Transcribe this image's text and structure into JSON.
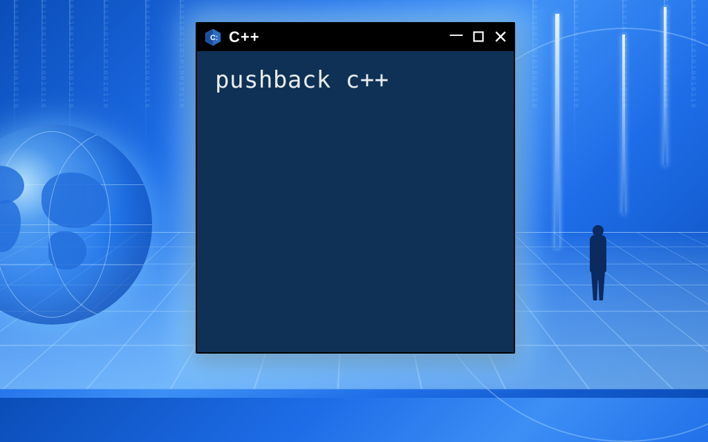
{
  "window": {
    "title": "C++",
    "icon_name": "cpp-icon"
  },
  "terminal": {
    "content": "pushback c++"
  },
  "controls": {
    "minimize": "—",
    "maximize": "▢",
    "close": "✕"
  },
  "colors": {
    "terminal_bg": "#0f3155",
    "titlebar_bg": "#000000",
    "accent_glow": "#a0dcff"
  }
}
